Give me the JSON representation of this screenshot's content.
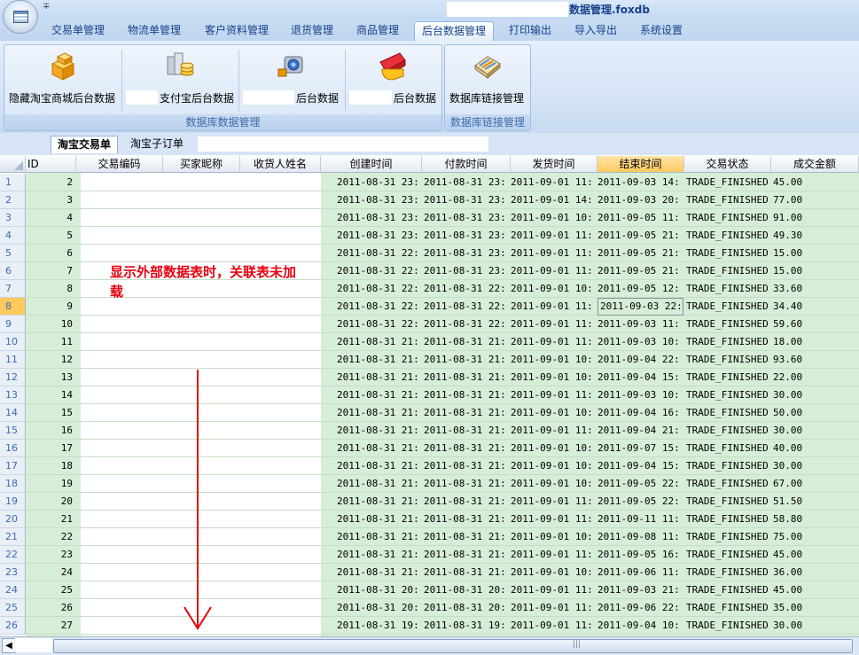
{
  "window": {
    "title": "数据管理.foxdb",
    "quick_access": "∓"
  },
  "tabs": [
    {
      "label": "交易单管理",
      "active": false
    },
    {
      "label": "物流单管理",
      "active": false
    },
    {
      "label": "客户资料管理",
      "active": false
    },
    {
      "label": "退货管理",
      "active": false
    },
    {
      "label": "商品管理",
      "active": false
    },
    {
      "label": "后台数据管理",
      "active": true
    },
    {
      "label": "打印输出",
      "active": false
    },
    {
      "label": "导入导出",
      "active": false
    },
    {
      "label": "系统设置",
      "active": false
    }
  ],
  "ribbon": {
    "group1": {
      "label": "数据库数据管理",
      "buttons": [
        {
          "label": "隐藏淘宝商城后台数据",
          "icon": "boxes-icon"
        },
        {
          "label": "支付宝后台数据",
          "icon": "alipay-icon"
        },
        {
          "label": "后台数据",
          "icon": "camera-icon"
        },
        {
          "label": "后台数据",
          "icon": "eraser-icon"
        }
      ]
    },
    "group2": {
      "label": "数据库链接管理",
      "buttons": [
        {
          "label": "数据库链接管理",
          "icon": "database-link-icon"
        }
      ]
    }
  },
  "subtabs": [
    {
      "label": "淘宝交易单",
      "active": true
    },
    {
      "label": "淘宝子订单",
      "active": false
    }
  ],
  "grid": {
    "columns": [
      "ID",
      "交易编码",
      "买家昵称",
      "收货人姓名",
      "创建时间",
      "付款时间",
      "发货时间",
      "结束时间",
      "交易状态",
      "成交金额"
    ],
    "selected_column": "结束时间",
    "selected_row": 8,
    "rows": [
      {
        "n": "1",
        "id": "2",
        "created": "2011-08-31 23:",
        "paid": "2011-08-31 23:",
        "shipped": "2011-09-01 11:",
        "ended": "2011-09-03 14:",
        "status": "TRADE_FINISHED",
        "amount": "45.00"
      },
      {
        "n": "2",
        "id": "3",
        "created": "2011-08-31 23:",
        "paid": "2011-08-31 23:",
        "shipped": "2011-09-01 14:",
        "ended": "2011-09-03 20:",
        "status": "TRADE_FINISHED",
        "amount": "77.00"
      },
      {
        "n": "3",
        "id": "4",
        "created": "2011-08-31 23:",
        "paid": "2011-08-31 23:",
        "shipped": "2011-09-01 10:",
        "ended": "2011-09-05 11:",
        "status": "TRADE_FINISHED",
        "amount": "91.00"
      },
      {
        "n": "4",
        "id": "5",
        "created": "2011-08-31 23:",
        "paid": "2011-08-31 23:",
        "shipped": "2011-09-01 11:",
        "ended": "2011-09-05 21:",
        "status": "TRADE_FINISHED",
        "amount": "49.30"
      },
      {
        "n": "5",
        "id": "6",
        "created": "2011-08-31 22:",
        "paid": "2011-08-31 23:",
        "shipped": "2011-09-01 11:",
        "ended": "2011-09-05 21:",
        "status": "TRADE_FINISHED",
        "amount": "15.00"
      },
      {
        "n": "6",
        "id": "7",
        "created": "2011-08-31 22:",
        "paid": "2011-08-31 23:",
        "shipped": "2011-09-01 11:",
        "ended": "2011-09-05 21:",
        "status": "TRADE_FINISHED",
        "amount": "15.00"
      },
      {
        "n": "7",
        "id": "8",
        "created": "2011-08-31 22:",
        "paid": "2011-08-31 22:",
        "shipped": "2011-09-01 10:",
        "ended": "2011-09-05 12:",
        "status": "TRADE_FINISHED",
        "amount": "33.60"
      },
      {
        "n": "8",
        "id": "9",
        "created": "2011-08-31 22:",
        "paid": "2011-08-31 22:",
        "shipped": "2011-09-01 11:",
        "ended": "2011-09-03 22:",
        "status": "TRADE_FINISHED",
        "amount": "34.40"
      },
      {
        "n": "9",
        "id": "10",
        "created": "2011-08-31 22:",
        "paid": "2011-08-31 22:",
        "shipped": "2011-09-01 11:",
        "ended": "2011-09-03 11:",
        "status": "TRADE_FINISHED",
        "amount": "59.60"
      },
      {
        "n": "10",
        "id": "11",
        "created": "2011-08-31 21:",
        "paid": "2011-08-31 21:",
        "shipped": "2011-09-01 11:",
        "ended": "2011-09-03 10:",
        "status": "TRADE_FINISHED",
        "amount": "18.00"
      },
      {
        "n": "11",
        "id": "12",
        "created": "2011-08-31 21:",
        "paid": "2011-08-31 21:",
        "shipped": "2011-09-01 10:",
        "ended": "2011-09-04 22:",
        "status": "TRADE_FINISHED",
        "amount": "93.60"
      },
      {
        "n": "12",
        "id": "13",
        "created": "2011-08-31 21:",
        "paid": "2011-08-31 21:",
        "shipped": "2011-09-01 10:",
        "ended": "2011-09-04 15:",
        "status": "TRADE_FINISHED",
        "amount": "22.00"
      },
      {
        "n": "13",
        "id": "14",
        "created": "2011-08-31 21:",
        "paid": "2011-08-31 21:",
        "shipped": "2011-09-01 11:",
        "ended": "2011-09-03 10:",
        "status": "TRADE_FINISHED",
        "amount": "30.00"
      },
      {
        "n": "14",
        "id": "15",
        "created": "2011-08-31 21:",
        "paid": "2011-08-31 21:",
        "shipped": "2011-09-01 10:",
        "ended": "2011-09-04 16:",
        "status": "TRADE_FINISHED",
        "amount": "50.00"
      },
      {
        "n": "15",
        "id": "16",
        "created": "2011-08-31 21:",
        "paid": "2011-08-31 21:",
        "shipped": "2011-09-01 11:",
        "ended": "2011-09-04 21:",
        "status": "TRADE_FINISHED",
        "amount": "30.00"
      },
      {
        "n": "16",
        "id": "17",
        "created": "2011-08-31 21:",
        "paid": "2011-08-31 21:",
        "shipped": "2011-09-01 10:",
        "ended": "2011-09-07 15:",
        "status": "TRADE_FINISHED",
        "amount": "40.00"
      },
      {
        "n": "17",
        "id": "18",
        "created": "2011-08-31 21:",
        "paid": "2011-08-31 21:",
        "shipped": "2011-09-01 10:",
        "ended": "2011-09-04 15:",
        "status": "TRADE_FINISHED",
        "amount": "30.00"
      },
      {
        "n": "18",
        "id": "19",
        "created": "2011-08-31 21:",
        "paid": "2011-08-31 21:",
        "shipped": "2011-09-01 10:",
        "ended": "2011-09-05 22:",
        "status": "TRADE_FINISHED",
        "amount": "67.00"
      },
      {
        "n": "19",
        "id": "20",
        "created": "2011-08-31 21:",
        "paid": "2011-08-31 21:",
        "shipped": "2011-09-01 11:",
        "ended": "2011-09-05 22:",
        "status": "TRADE_FINISHED",
        "amount": "51.50"
      },
      {
        "n": "20",
        "id": "21",
        "created": "2011-08-31 21:",
        "paid": "2011-08-31 21:",
        "shipped": "2011-09-01 11:",
        "ended": "2011-09-11 11:",
        "status": "TRADE_FINISHED",
        "amount": "58.80"
      },
      {
        "n": "21",
        "id": "22",
        "created": "2011-08-31 21:",
        "paid": "2011-08-31 21:",
        "shipped": "2011-09-01 10:",
        "ended": "2011-09-08 11:",
        "status": "TRADE_FINISHED",
        "amount": "75.00"
      },
      {
        "n": "22",
        "id": "23",
        "created": "2011-08-31 21:",
        "paid": "2011-08-31 21:",
        "shipped": "2011-09-01 11:",
        "ended": "2011-09-05 16:",
        "status": "TRADE_FINISHED",
        "amount": "45.00"
      },
      {
        "n": "23",
        "id": "24",
        "created": "2011-08-31 21:",
        "paid": "2011-08-31 21:",
        "shipped": "2011-09-01 10:",
        "ended": "2011-09-06 11:",
        "status": "TRADE_FINISHED",
        "amount": "36.00"
      },
      {
        "n": "24",
        "id": "25",
        "created": "2011-08-31 20:",
        "paid": "2011-08-31 20:",
        "shipped": "2011-09-01 11:",
        "ended": "2011-09-03 21:",
        "status": "TRADE_FINISHED",
        "amount": "45.00"
      },
      {
        "n": "25",
        "id": "26",
        "created": "2011-08-31 20:",
        "paid": "2011-08-31 20:",
        "shipped": "2011-09-01 11:",
        "ended": "2011-09-06 22:",
        "status": "TRADE_FINISHED",
        "amount": "35.00"
      },
      {
        "n": "26",
        "id": "27",
        "created": "2011-08-31 19:",
        "paid": "2011-08-31 19:",
        "shipped": "2011-09-01 11:",
        "ended": "2011-09-04 10:",
        "status": "TRADE_FINISHED",
        "amount": "30.00"
      }
    ]
  },
  "annotation": {
    "text": "显示外部数据表时，关联表未加载",
    "color": "#e8000f"
  },
  "scroll": {
    "thumb_grip": "|||"
  },
  "colors": {
    "tab_text": "#15428b",
    "green_cells": "#d6eed8",
    "selected_header": "#ffc95c",
    "arrow": "#e8000f"
  }
}
